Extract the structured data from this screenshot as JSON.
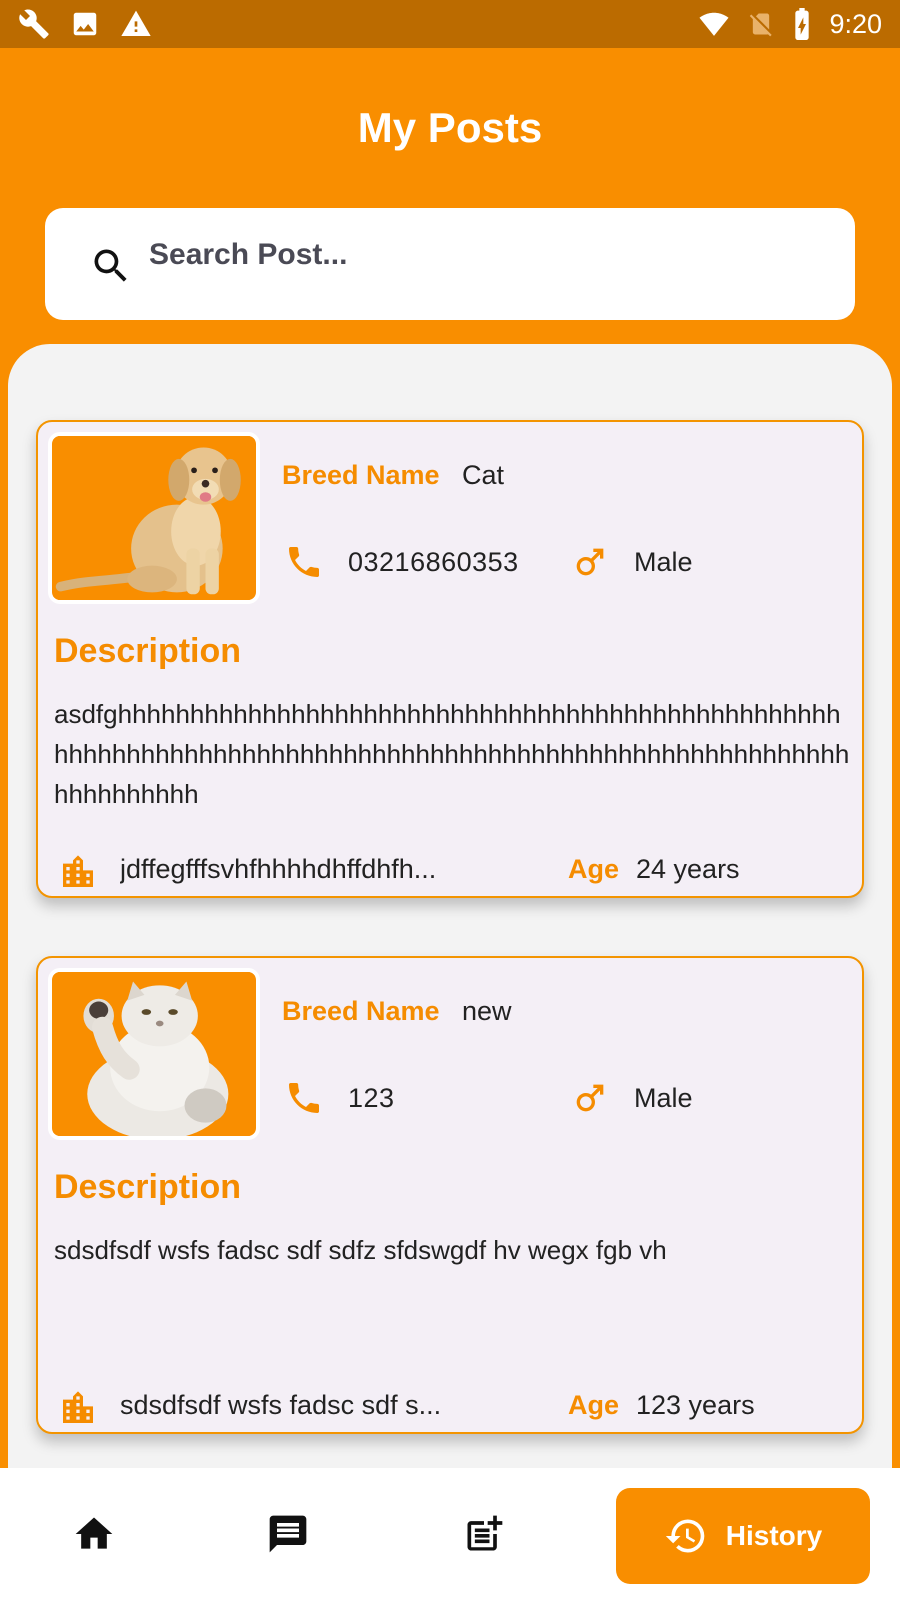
{
  "status_bar": {
    "time": "9:20",
    "icons": [
      "wrench-icon",
      "image-icon",
      "warning-icon",
      "wifi-icon",
      "no-sim-icon",
      "battery-charging-icon"
    ]
  },
  "header": {
    "title": "My Posts"
  },
  "search": {
    "placeholder": "Search Post..."
  },
  "posts": [
    {
      "image": "dog-photo",
      "breed_label": "Breed Name",
      "breed": "Cat",
      "phone": "03216860353",
      "gender": "Male",
      "description_label": "Description",
      "description": "asdfghhhhhhhhhhhhhhhhhhhhhhhhhhhhhhhhhhhhhhhhhhhhhhhhhhhhhhhhhhhhhhhhhhhhhhhhhhhhhhhhhhhhhhhhhhhhhhhhhhhhhhhhhhhhhhhhhhh",
      "address": "jdffegfffsvhfhhhhdhffdhfh...",
      "age_label": "Age",
      "age": "24 years"
    },
    {
      "image": "cat-photo",
      "breed_label": "Breed Name",
      "breed": "new",
      "phone": "123",
      "gender": "Male",
      "description_label": "Description",
      "description": "sdsdfsdf wsfs fadsc sdf sdfz sfdswgdf hv wegx fgb vh",
      "address": "sdsdfsdf wsfs fadsc sdf s...",
      "age_label": "Age",
      "age": "123 years"
    }
  ],
  "bottom_nav": {
    "items": [
      {
        "icon": "home-icon"
      },
      {
        "icon": "chat-icon"
      },
      {
        "icon": "add-post-icon"
      }
    ],
    "active": {
      "icon": "history-icon",
      "label": "History"
    }
  },
  "colors": {
    "accent": "#f98e00",
    "status_bar": "#bb6b00",
    "card_bg": "#f4eff6",
    "panel_bg": "#f3f3f3"
  }
}
